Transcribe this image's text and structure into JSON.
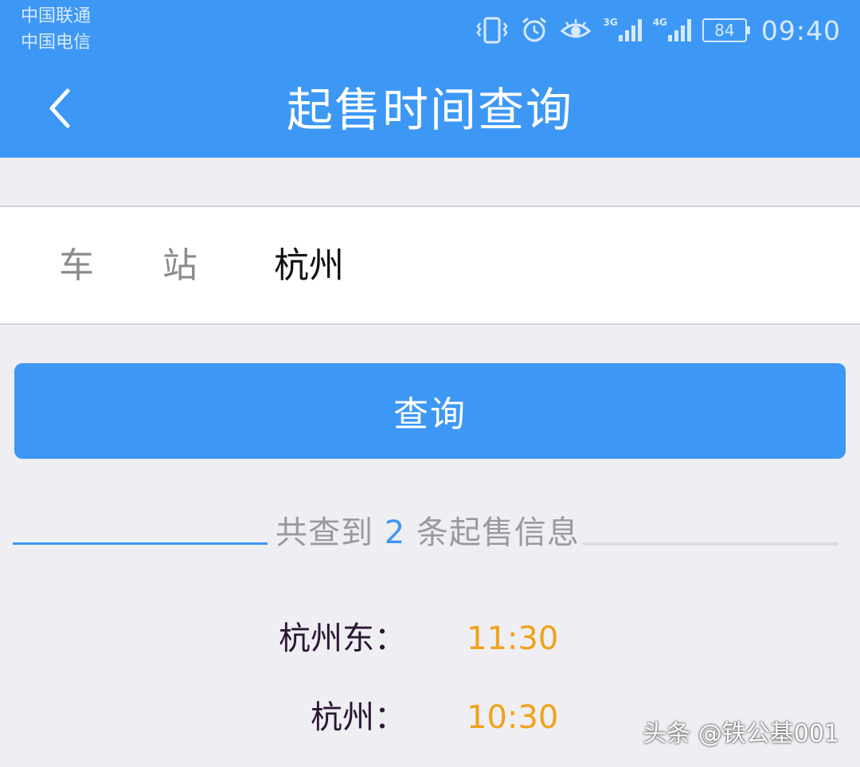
{
  "status_bar": {
    "carrier_1": "中国联通",
    "carrier_2": "中国电信",
    "network_1": "3G",
    "network_2": "4G",
    "battery": "84",
    "time": "09:40",
    "icons": [
      "vibrate-icon",
      "alarm-icon",
      "eye-icon",
      "signal-icon",
      "signal-icon",
      "battery-icon"
    ]
  },
  "header": {
    "title": "起售时间查询",
    "back_icon": "chevron-left-icon"
  },
  "form": {
    "station_label": "车站",
    "station_value": "杭州"
  },
  "query_button": {
    "label": "查询"
  },
  "results": {
    "summary_prefix": "共查到",
    "count": "2",
    "summary_suffix": "条起售信息",
    "items": [
      {
        "station": "杭州东：",
        "time": "11:30"
      },
      {
        "station": "杭州：",
        "time": "10:30"
      }
    ]
  },
  "watermark": "头条 @铁公基001",
  "colors": {
    "primary": "#3d98f5",
    "time_accent": "#f0a21a",
    "background": "#efeef3"
  }
}
